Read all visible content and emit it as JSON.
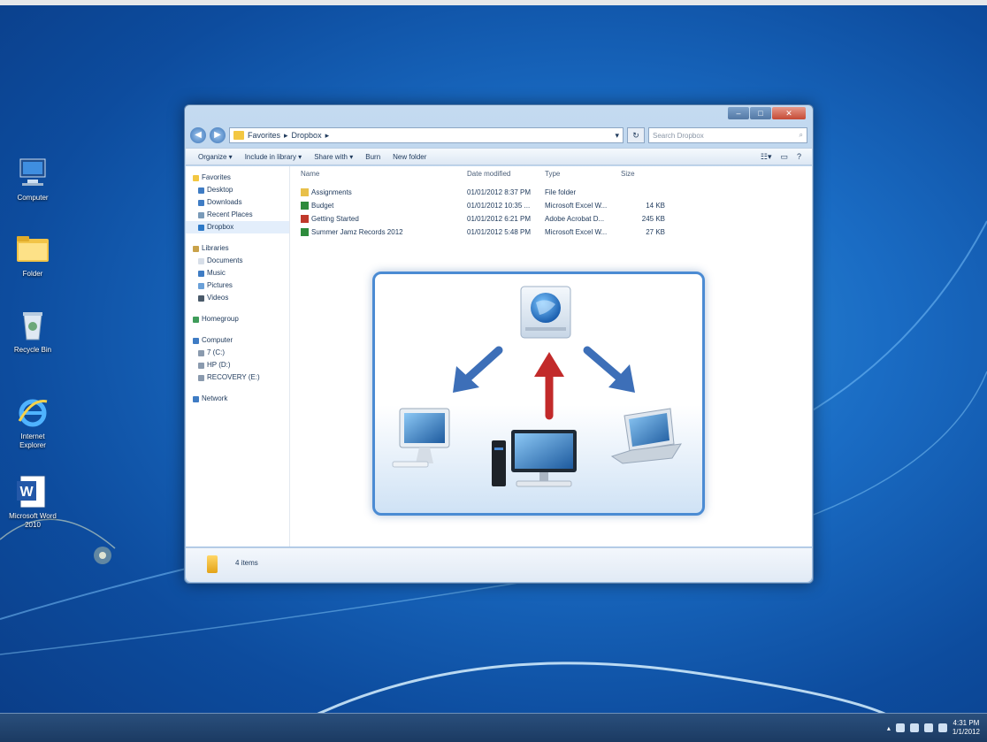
{
  "desktop": {
    "icons": [
      {
        "label": "Computer",
        "icon": "computer-icon"
      },
      {
        "label": "Folder",
        "icon": "folder-icon"
      },
      {
        "label": "Recycle Bin",
        "icon": "recycle-bin-icon"
      },
      {
        "label": "Internet Explorer",
        "icon": "internet-explorer-icon"
      },
      {
        "label": "Microsoft Word 2010",
        "icon": "word-icon"
      }
    ]
  },
  "window": {
    "controls": {
      "minimize": "–",
      "maximize": "□",
      "close": "✕"
    },
    "address": {
      "path": [
        "Favorites",
        "Dropbox"
      ]
    },
    "search_placeholder": "Search Dropbox",
    "toolbar": {
      "organize": "Organize ▾",
      "include_in_library": "Include in library ▾",
      "share_with": "Share with ▾",
      "burn": "Burn",
      "new_folder": "New folder"
    },
    "nav": {
      "favorites_header": "Favorites",
      "favorites": [
        "Desktop",
        "Downloads",
        "Recent Places",
        "Dropbox"
      ],
      "libraries_header": "Libraries",
      "libraries": [
        "Documents",
        "Music",
        "Pictures",
        "Videos"
      ],
      "homegroup": "Homegroup",
      "computer_header": "Computer",
      "drives": [
        "7 (C:)",
        "HP (D:)",
        "RECOVERY (E:)"
      ],
      "network": "Network"
    },
    "columns": [
      "Name",
      "Date modified",
      "Type",
      "Size"
    ],
    "files": [
      {
        "name": "Assignments",
        "date": "01/01/2012 8:37 PM",
        "type": "File folder",
        "size": "",
        "color": "#e8c04a"
      },
      {
        "name": "Budget",
        "date": "01/01/2012 10:35 ...",
        "type": "Microsoft Excel W...",
        "size": "14 KB",
        "color": "#2e8b3c"
      },
      {
        "name": "Getting Started",
        "date": "01/01/2012 6:21 PM",
        "type": "Adobe Acrobat D...",
        "size": "245 KB",
        "color": "#c0392b"
      },
      {
        "name": "Summer Jamz Records 2012",
        "date": "01/01/2012 5:48 PM",
        "type": "Microsoft Excel W...",
        "size": "27 KB",
        "color": "#2e8b3c"
      }
    ],
    "status_text": "4 items"
  },
  "taskbar": {
    "clock_time": "4:31 PM",
    "clock_date": "1/1/2012"
  }
}
